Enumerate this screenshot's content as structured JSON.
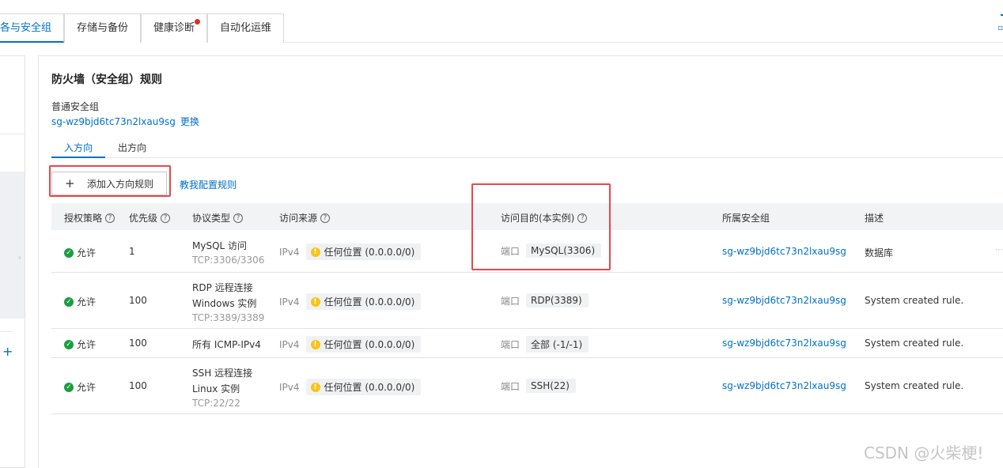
{
  "tabs": [
    {
      "label": "各与安全组",
      "active": true
    },
    {
      "label": "存储与备份",
      "active": false
    },
    {
      "label": "健康诊断",
      "active": false,
      "has_dot": true
    },
    {
      "label": "自动化运维",
      "active": false
    }
  ],
  "panel": {
    "title": "防火墙（安全组）规则",
    "sg_type": "普通安全组",
    "sg_id": "sg-wz9bjd6tc73n2lxau9sg",
    "change_label": "更换"
  },
  "direction_tabs": {
    "inbound": "入方向",
    "outbound": "出方向"
  },
  "toolbar": {
    "add_label": "添加入方向规则",
    "teach_label": "教我配置规则"
  },
  "columns": {
    "policy": "授权策略",
    "priority": "优先级",
    "protocol": "协议类型",
    "source": "访问来源",
    "dest": "访问目的(本实例)",
    "group": "所属安全组",
    "desc": "描述"
  },
  "rows": [
    {
      "policy": "允许",
      "priority": "1",
      "proto_name": "MySQL 访问",
      "proto_sub": "TCP:3306/3306",
      "ip": "IPv4",
      "source": "任何位置 (0.0.0.0/0)",
      "port_label": "端口",
      "port": "MySQL(3306)",
      "group": "sg-wz9bjd6tc73n2lxau9sg",
      "desc": "数据库"
    },
    {
      "policy": "允许",
      "priority": "100",
      "proto_name": "RDP 远程连接",
      "proto_name2": "Windows 实例",
      "proto_sub": "TCP:3389/3389",
      "ip": "IPv4",
      "source": "任何位置 (0.0.0.0/0)",
      "port_label": "端口",
      "port": "RDP(3389)",
      "group": "sg-wz9bjd6tc73n2lxau9sg",
      "desc": "System created rule."
    },
    {
      "policy": "允许",
      "priority": "100",
      "proto_name": "所有 ICMP-IPv4",
      "ip": "IPv4",
      "source": "任何位置 (0.0.0.0/0)",
      "port_label": "端口",
      "port": "全部 (-1/-1)",
      "group": "sg-wz9bjd6tc73n2lxau9sg",
      "desc": "System created rule."
    },
    {
      "policy": "允许",
      "priority": "100",
      "proto_name": "SSH 远程连接",
      "proto_name2": "Linux 实例",
      "proto_sub": "TCP:22/22",
      "ip": "IPv4",
      "source": "任何位置 (0.0.0.0/0)",
      "port_label": "端口",
      "port": "SSH(22)",
      "group": "sg-wz9bjd6tc73n2lxau9sg",
      "desc": "System created rule."
    }
  ],
  "watermark": "CSDN @火柴梗!",
  "colors": {
    "accent": "#0070cc",
    "success": "#1a9e3f",
    "warning": "#f5c518",
    "highlight_box": "#e8474b",
    "dot": "#d93026"
  }
}
